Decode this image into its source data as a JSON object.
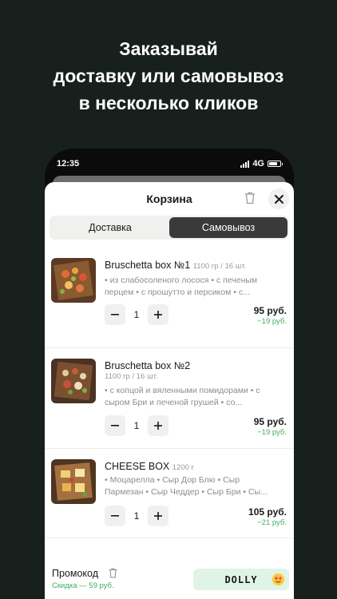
{
  "promo_headline": {
    "line1": "Заказывай",
    "line2": "доставку или самовывоз",
    "line3": "в несколько кликов"
  },
  "status_bar": {
    "time": "12:35",
    "network": "4G"
  },
  "cart": {
    "title": "Корзина",
    "tabs": [
      {
        "label": "Доставка",
        "active": false
      },
      {
        "label": "Самовывоз",
        "active": true
      }
    ],
    "items": [
      {
        "name": "Bruschetta box №1",
        "weight": "1100 гр / 16 шт.",
        "desc_line1": "• из слабосоленого лосося • с печеным",
        "desc_line2": "перцем • с прошутто и персиком • с...",
        "quantity": "1",
        "price": "95 руб.",
        "discount": "−19 руб."
      },
      {
        "name": "Bruschetta box №2",
        "weight": "1100 гр / 16 шт.",
        "desc_line1": "• с копцой и вяленными помидорами • с",
        "desc_line2": "сыром Бри и печеной грушей • со...",
        "quantity": "1",
        "price": "95 руб.",
        "discount": "−19 руб."
      },
      {
        "name": "CHEESE BOX",
        "weight": "1200 г",
        "desc_line1": "• Моцарелла • Сыр Дор Блю • Сыр",
        "desc_line2": "Пармезан • Сыр Чеддер • Сыр Бри • Сы...",
        "quantity": "1",
        "price": "105 руб.",
        "discount": "−21 руб."
      }
    ],
    "promo": {
      "label": "Промокод",
      "discount": "Скидка — 59 руб.",
      "code": "DOLLY"
    }
  },
  "colors": {
    "background": "#17201d",
    "accent_green": "#3fae5c",
    "promo_bg": "#dff4e6",
    "active_tab": "#3a3a3a"
  },
  "icons": [
    "trash-icon",
    "close-icon",
    "minus-icon",
    "plus-icon",
    "signal-icon",
    "battery-icon",
    "smile-emoji-icon"
  ]
}
